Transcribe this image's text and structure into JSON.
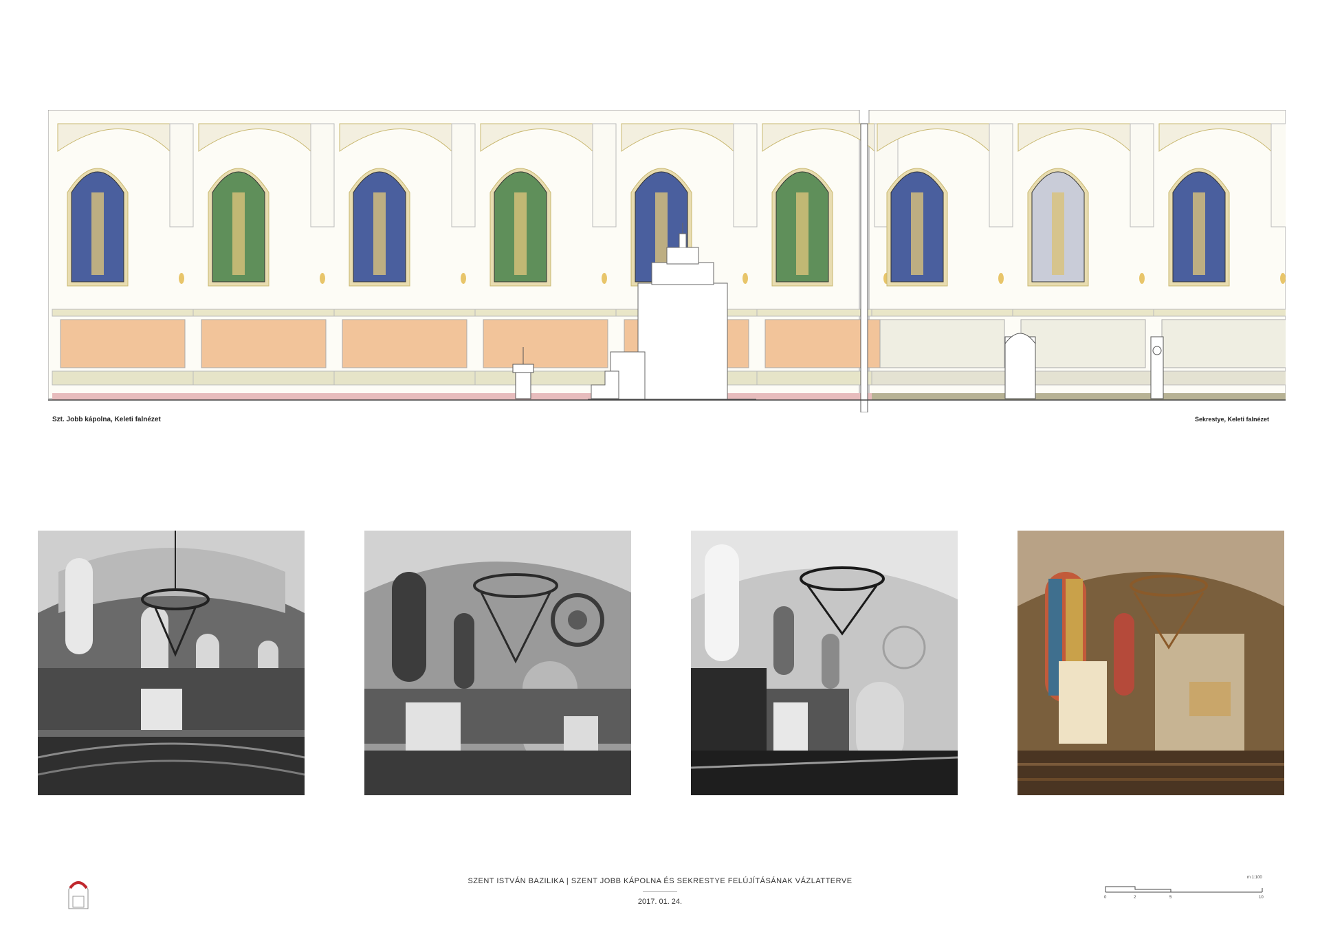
{
  "elevation": {
    "caption_left": "Szt. Jobb kápolna, Keleti falnézet",
    "caption_right": "Sekrestye, Keleti falnézet"
  },
  "photos": [
    {
      "tone": "bw"
    },
    {
      "tone": "bw-soft"
    },
    {
      "tone": "bw-contrast"
    },
    {
      "tone": "color-render"
    }
  ],
  "footer": {
    "title": "SZENT ISTVÁN BAZILIKA  |  SZENT JOBB KÁPOLNA ÉS SEKRESTYE FELÚJÍTÁSÁNAK VÁZLATTERVE",
    "date": "2017. 01. 24."
  },
  "scale_bar": {
    "label": "m 1:100",
    "ticks": [
      "0",
      "2",
      "5",
      "10"
    ]
  },
  "colors": {
    "glass_blue": "#4a5f9e",
    "glass_green": "#5f8f5a",
    "panel_peach": "#f2c49a",
    "skirting_pink": "#e7bcbc",
    "sacristy_olive": "#b7b294",
    "moulding_gold": "#c9b870",
    "render_amber": "#9c7a4e"
  }
}
